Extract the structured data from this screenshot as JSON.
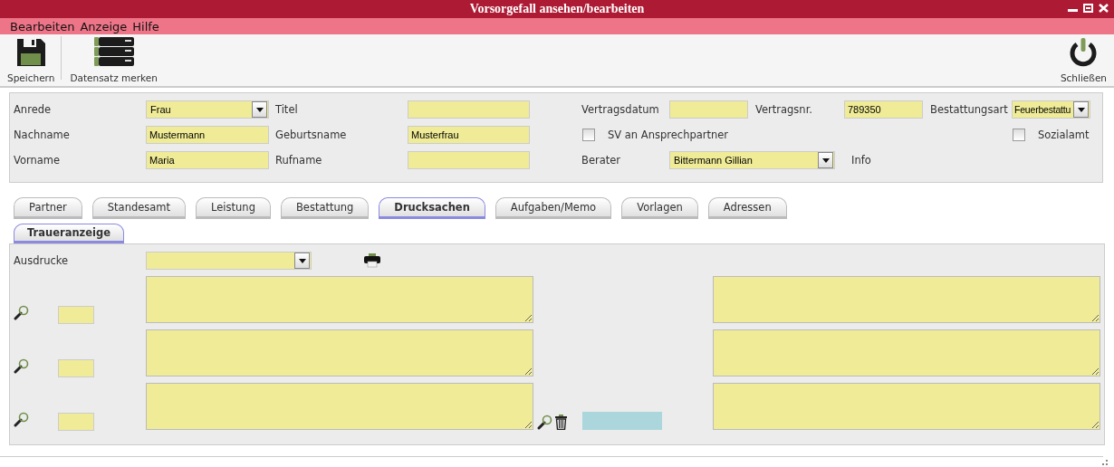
{
  "window": {
    "title": "Vorsorgefall ansehen/bearbeiten"
  },
  "menu": [
    "Bearbeiten",
    "Anzeige",
    "Hilfe"
  ],
  "toolbar": [
    {
      "label": "Speichern",
      "kind": "save"
    },
    {
      "label": "Datensatz merken",
      "kind": "records"
    },
    {
      "label": "Schließen",
      "kind": "close"
    }
  ],
  "person": [
    {
      "label": "Anrede",
      "kind": "select",
      "value": "Frau"
    },
    {
      "label": "Titel",
      "kind": "input"
    },
    {
      "label": "Nachname",
      "kind": "input",
      "value": "Mustermann"
    },
    {
      "label": "Geburtsname",
      "kind": "input",
      "value": "Musterfrau"
    },
    {
      "label": "Vorname",
      "kind": "input",
      "value": "Maria"
    },
    {
      "label": "Rufname",
      "kind": "input"
    }
  ],
  "contract": {
    "vertragsdatum": {
      "label": "Vertragsdatum"
    },
    "vertragsnr": {
      "label": "Vertragsnr.",
      "value": "789350"
    },
    "bestattungsart": {
      "label": "Bestattungsart",
      "value": "Feuerbestattu"
    },
    "sv": {
      "label": "SV an Ansprechpartner",
      "checked": false
    },
    "sozialamt": {
      "label": "Sozialamt",
      "checked": false
    },
    "berater": {
      "label": "Berater",
      "value": "Bittermann Gillian"
    },
    "info": {
      "label": "Info"
    }
  },
  "tabs": [
    {
      "label": "Partner",
      "selected": false
    },
    {
      "label": "Standesamt",
      "selected": false
    },
    {
      "label": "Leistung",
      "selected": false
    },
    {
      "label": "Bestattung",
      "selected": false
    },
    {
      "label": "Drucksachen",
      "selected": true
    },
    {
      "label": "Aufgaben/Memo",
      "selected": false
    },
    {
      "label": "Vorlagen",
      "selected": false
    },
    {
      "label": "Adressen",
      "selected": false
    }
  ],
  "subtabs": [
    {
      "label": "Traueranzeige",
      "selected": true
    }
  ],
  "prints": {
    "label": "Ausdrucke"
  },
  "text_rows": [
    {
      "kind": "plain"
    },
    {
      "kind": "plain"
    },
    {
      "kind": "actions"
    }
  ]
}
